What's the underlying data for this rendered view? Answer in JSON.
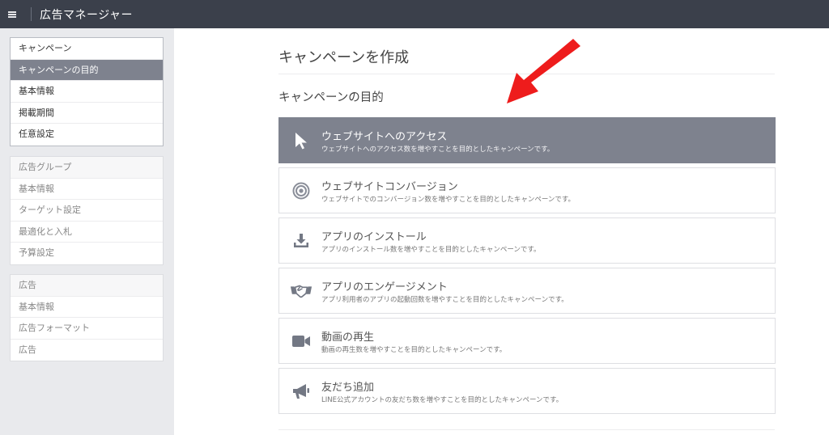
{
  "app": {
    "title": "広告マネージャー"
  },
  "sidebar": {
    "campaign_group": [
      "キャンペーン",
      "キャンペーンの目的",
      "基本情報",
      "掲載期間",
      "任意設定"
    ],
    "adgroup_group": [
      "広告グループ",
      "基本情報",
      "ターゲット設定",
      "最適化と入札",
      "予算設定"
    ],
    "ad_group": [
      "広告",
      "基本情報",
      "広告フォーマット",
      "広告"
    ]
  },
  "main": {
    "page_title": "キャンペーンを作成",
    "section_title": "キャンペーンの目的",
    "options": [
      {
        "title": "ウェブサイトへのアクセス",
        "desc": "ウェブサイトへのアクセス数を増やすことを目的としたキャンペーンです。",
        "icon": "cursor-icon",
        "selected": true
      },
      {
        "title": "ウェブサイトコンバージョン",
        "desc": "ウェブサイトでのコンバージョン数を増やすことを目的としたキャンペーンです。",
        "icon": "target-icon",
        "selected": false
      },
      {
        "title": "アプリのインストール",
        "desc": "アプリのインストール数を増やすことを目的としたキャンペーンです。",
        "icon": "download-icon",
        "selected": false
      },
      {
        "title": "アプリのエンゲージメント",
        "desc": "アプリ利用者のアプリの起動回数を増やすことを目的としたキャンペーンです。",
        "icon": "handshake-icon",
        "selected": false
      },
      {
        "title": "動画の再生",
        "desc": "動画の再生数を増やすことを目的としたキャンペーンです。",
        "icon": "video-camera-icon",
        "selected": false
      },
      {
        "title": "友だち追加",
        "desc": "LINE公式アカウントの友だち数を増やすことを目的としたキャンペーンです。",
        "icon": "megaphone-icon",
        "selected": false
      }
    ]
  },
  "colors": {
    "topbar": "#3b404b",
    "selected": "#7e828e",
    "annotation_arrow": "#ee1c1c"
  }
}
